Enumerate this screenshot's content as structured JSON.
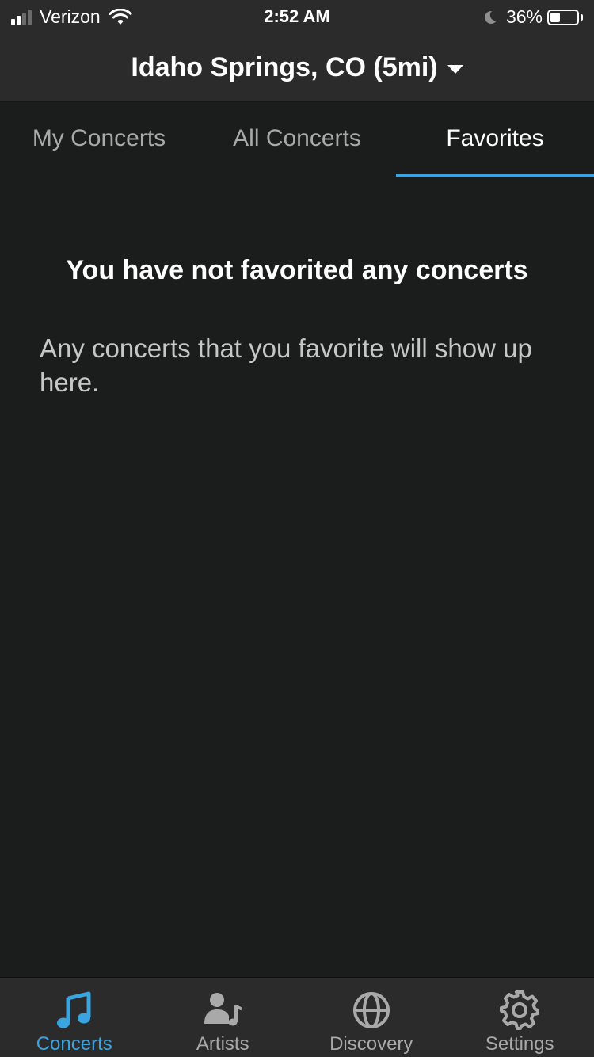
{
  "status_bar": {
    "carrier": "Verizon",
    "time": "2:52 AM",
    "battery_percent": "36%",
    "battery_level": 0.36,
    "icons": [
      "signal-icon",
      "wifi-icon",
      "moon-icon",
      "battery-icon"
    ]
  },
  "header": {
    "location": "Idaho Springs, CO (5mi)"
  },
  "tabs": [
    {
      "label": "My Concerts",
      "active": false
    },
    {
      "label": "All Concerts",
      "active": false
    },
    {
      "label": "Favorites",
      "active": true
    }
  ],
  "empty_state": {
    "title": "You have not favorited any concerts",
    "message": "Any concerts that you favorite will show up here."
  },
  "tabbar": {
    "items": [
      {
        "label": "Concerts",
        "icon": "music-note-icon",
        "active": true
      },
      {
        "label": "Artists",
        "icon": "artist-icon",
        "active": false
      },
      {
        "label": "Discovery",
        "icon": "globe-icon",
        "active": false
      },
      {
        "label": "Settings",
        "icon": "gear-icon",
        "active": false
      }
    ]
  },
  "colors": {
    "accent": "#3aa4e0",
    "background": "#1b1c1c",
    "bar": "#2b2b2b",
    "inactive": "#a9a9a9"
  }
}
